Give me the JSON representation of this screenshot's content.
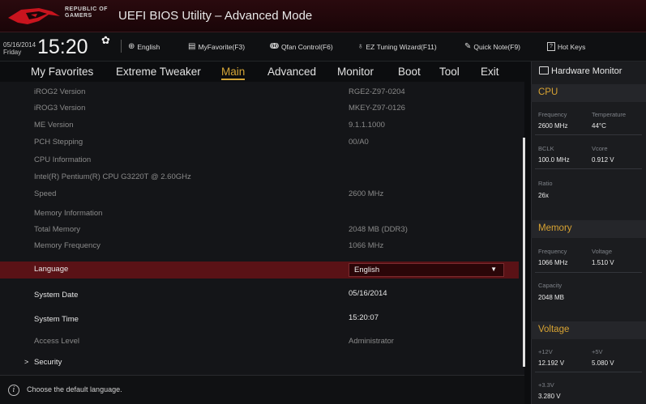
{
  "titlebar": {
    "brand_line1": "REPUBLIC OF",
    "brand_line2": "GAMERS",
    "title": "UEFI BIOS Utility – Advanced Mode"
  },
  "toolbar": {
    "date": "05/16/2014",
    "day": "Friday",
    "time": "15:20",
    "language": "English",
    "myfavorite": "MyFavorite(F3)",
    "qfan": "Qfan Control(F6)",
    "ez_tuning": "EZ Tuning Wizard(F11)",
    "quick_note": "Quick Note(F9)",
    "hot_keys": "Hot Keys"
  },
  "nav": {
    "tabs": [
      "My Favorites",
      "Extreme Tweaker",
      "Main",
      "Advanced",
      "Monitor",
      "Boot",
      "Tool",
      "Exit"
    ],
    "active": "Main"
  },
  "main": {
    "rows": [
      {
        "label": "iROG2 Version",
        "value": "RGE2-Z97-0204"
      },
      {
        "label": "iROG3 Version",
        "value": "MKEY-Z97-0126"
      },
      {
        "label": "ME Version",
        "value": "9.1.1.1000"
      },
      {
        "label": "PCH Stepping",
        "value": "00/A0"
      },
      {
        "label": "CPU Information",
        "value": ""
      },
      {
        "label": "Intel(R) Pentium(R) CPU G3220T @ 2.60GHz",
        "value": ""
      },
      {
        "label": "Speed",
        "value": "2600 MHz"
      },
      {
        "label": "Memory Information",
        "value": ""
      },
      {
        "label": "Total Memory",
        "value": "2048 MB (DDR3)"
      },
      {
        "label": "Memory Frequency",
        "value": "1066 MHz"
      }
    ],
    "language_label": "Language",
    "language_value": "English",
    "system_date_label": "System Date",
    "system_date_value": "05/16/2014",
    "system_time_label": "System Time",
    "system_time_value": "15:20:07",
    "access_level_label": "Access Level",
    "access_level_value": "Administrator",
    "security_label": "Security"
  },
  "status": {
    "help_text": "Choose the default language."
  },
  "hardware_monitor": {
    "title": "Hardware Monitor",
    "cpu": {
      "section": "CPU",
      "frequency_label": "Frequency",
      "frequency": "2600 MHz",
      "temperature_label": "Temperature",
      "temperature": "44°C",
      "bclk_label": "BCLK",
      "bclk": "100.0 MHz",
      "vcore_label": "Vcore",
      "vcore": "0.912 V",
      "ratio_label": "Ratio",
      "ratio": "26x"
    },
    "memory": {
      "section": "Memory",
      "frequency_label": "Frequency",
      "frequency": "1066 MHz",
      "voltage_label": "Voltage",
      "voltage": "1.510 V",
      "capacity_label": "Capacity",
      "capacity": "2048 MB"
    },
    "voltage": {
      "section": "Voltage",
      "v12_label": "+12V",
      "v12": "12.192 V",
      "v5_label": "+5V",
      "v5": "5.080 V",
      "v33_label": "+3.3V",
      "v33": "3.280 V"
    }
  },
  "colors": {
    "accent": "#d4a537",
    "selected_row": "#5a1216",
    "titlebar": "#2a0a0e"
  }
}
